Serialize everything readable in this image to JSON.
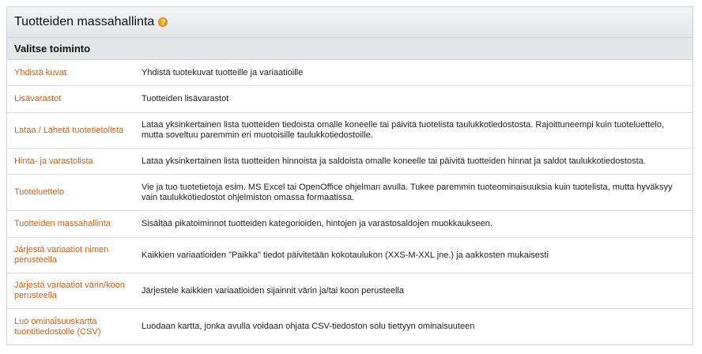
{
  "header": {
    "title": "Tuotteiden massahallinta",
    "help_glyph": "?"
  },
  "section": {
    "title": "Valitse toiminto"
  },
  "rows": [
    {
      "label": "Yhdistä kuvat",
      "description": "Yhdistä tuotekuvat tuotteille ja variaatioille"
    },
    {
      "label": "Lisävarastot",
      "description": "Tuotteiden lisävarastot"
    },
    {
      "label": "Lataa / Lähetä tuotetietolista",
      "description": "Lataa yksinkertainen lista tuotteiden tiedoista omalle koneelle tai päivitä tuotelista taulukkotiedostosta. Rajoittuneempi kuin tuoteluettelo, mutta soveltuu paremmin eri muotoisille taulukkotiedostoille."
    },
    {
      "label": "Hinta- ja varastolista",
      "description": "Lataa yksinkertainen lista tuotteiden hinnoista ja saldoista omalle koneelle tai päivitä tuotteiden hinnat ja saldot taulukkotiedostosta."
    },
    {
      "label": "Tuoteluettelo",
      "description": "Vie ja tuo tuotetietoja esim. MS Excel tai OpenOffice ohjelman avulla. Tukee paremmin tuoteominaisuuksia kuin tuotelista, mutta hyväksyy vain taulukkotiedostot ohjelmiston omassa formaatissa."
    },
    {
      "label": "Tuotteiden massahallinta",
      "description": "Sisältää pikatoiminnot tuotteiden kategorioiden, hintojen ja varastosaldojen muokkaukseen."
    },
    {
      "label": "Järjestä variaatiot nimen perusteella",
      "description": "Kaikkien variaatioiden \"Paikka\" tiedot päivitetään kokotaulukon (XXS-M-XXL jne.) ja aakkosten mukaisesti"
    },
    {
      "label": "Järjestä variaatiot värin/koon perusteella",
      "description": "Järjestele kaikkien variaatioiden sijainnit värin ja/tai koon perusteella"
    },
    {
      "label": "Luo ominaisuuskartta tuontitiedostolle (CSV)",
      "description": "Luodaan kartta, jonka avulla voidaan ohjata CSV-tiedoston solu tiettyyn ominaisuuteen"
    }
  ],
  "colors": {
    "link": "#d4621a",
    "header_bg": "#e4e7e9",
    "help_icon": "#f0a020"
  }
}
